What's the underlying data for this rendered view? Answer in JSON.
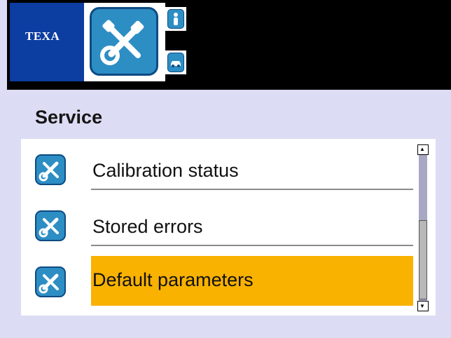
{
  "header": {
    "brand": "TEXA",
    "main_icon": "wrench-screwdriver-icon",
    "side_icons": [
      "person-icon",
      "car-icon"
    ]
  },
  "screen": {
    "title": "Service"
  },
  "menu": {
    "items": [
      {
        "label": "Calibration status",
        "icon": "wrench-screwdriver-icon",
        "selected": false
      },
      {
        "label": "Stored errors",
        "icon": "wrench-screwdriver-icon",
        "selected": false
      },
      {
        "label": "Default parameters",
        "icon": "wrench-screwdriver-icon",
        "selected": true
      }
    ]
  },
  "scrollbar": {
    "position": "bottom"
  },
  "colors": {
    "brand_blue": "#0c3da1",
    "icon_blue": "#2d8ec4",
    "selection": "#f9b200",
    "background": "#dcdcf4"
  }
}
